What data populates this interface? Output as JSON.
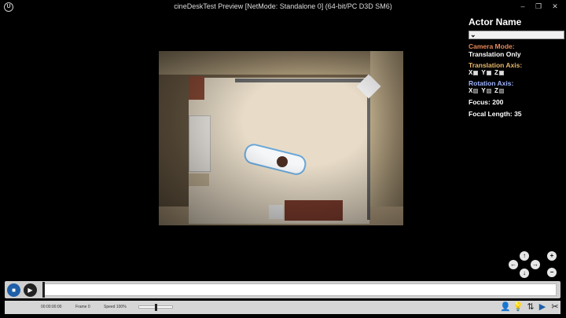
{
  "window": {
    "title": "cineDeskTest Preview [NetMode: Standalone 0]  (64-bit/PC D3D SM6)",
    "logo": "U",
    "minimize_icon": "–",
    "restore_icon": "❐",
    "close_icon": "✕"
  },
  "panel": {
    "actor_title": "Actor Name",
    "dropdown_value": "",
    "camera_mode_label": "Camera Mode:",
    "camera_mode_value": "Translation Only",
    "translation_axis_label": "Translation Axis:",
    "translation_axes": [
      "X",
      "Y",
      "Z"
    ],
    "rotation_axis_label": "Rotation Axis:",
    "rotation_axes": [
      "X",
      "Y",
      "Z"
    ],
    "focus_text": "Focus: 200",
    "focal_length_text": "Focal Length: 35",
    "colors": {
      "camera_mode": "#e8875a",
      "translation_axis": "#e8b86a",
      "rotation_axis": "#9fb4ff"
    }
  },
  "nav": {
    "up": "↑",
    "left": "←",
    "right": "→",
    "down": "↓",
    "zoom_in": "+",
    "zoom_out": "−"
  },
  "timeline": {
    "stop_icon": "■",
    "play_icon": "▶",
    "playhead_fraction": 0.0
  },
  "bottombar": {
    "timecode": "00:00:00:00",
    "frame": "Frame 0",
    "speed": "Speed 100%",
    "slider_level": 0.5,
    "icons": [
      "person-icon",
      "lightbulb-icon",
      "swap-icon",
      "camera-icon",
      "scissors-icon"
    ]
  }
}
